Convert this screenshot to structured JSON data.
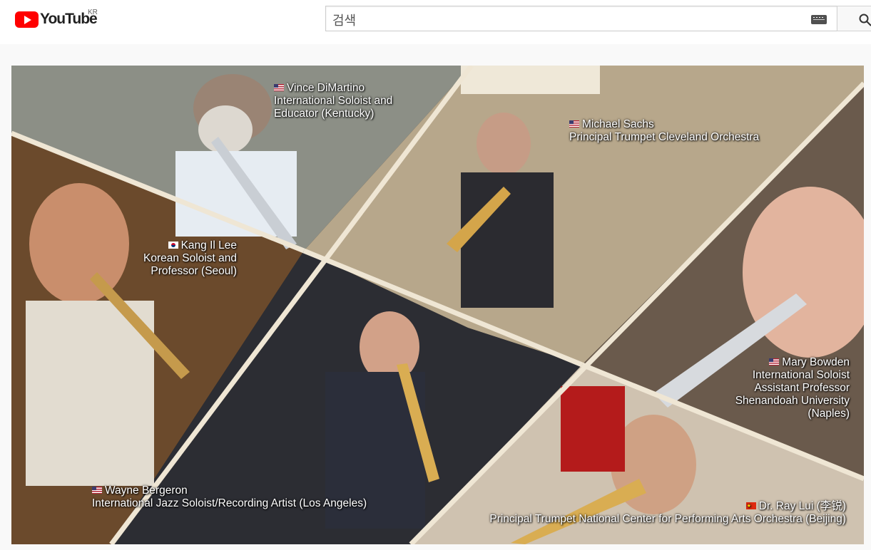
{
  "header": {
    "logo_text": "YouTube",
    "region": "KR",
    "search_placeholder": "검색"
  },
  "performers": [
    {
      "flag": "us",
      "name": "Vince DiMartino",
      "role": "International Soloist and Educator (Kentucky)"
    },
    {
      "flag": "us",
      "name": "Michael Sachs",
      "role": "Principal Trumpet Cleveland Orchestra"
    },
    {
      "flag": "kr",
      "name": "Kang Il Lee",
      "role": "Korean Soloist and Professor (Seoul)"
    },
    {
      "flag": "us",
      "name": "Mary Bowden",
      "role": "International Soloist Assistant Professor Shenandoah University (Naples)"
    },
    {
      "flag": "us",
      "name": "Wayne Bergeron",
      "role": "International Jazz Soloist/Recording Artist (Los Angeles)"
    },
    {
      "flag": "cn",
      "name": "Dr. Ray Lui (李锐)",
      "role": "Principal Trumpet National Center for Performing Arts Orchestra (Beijing)"
    }
  ],
  "colors": {
    "brand_red": "#ff0000",
    "divider": "#efe6d4"
  }
}
